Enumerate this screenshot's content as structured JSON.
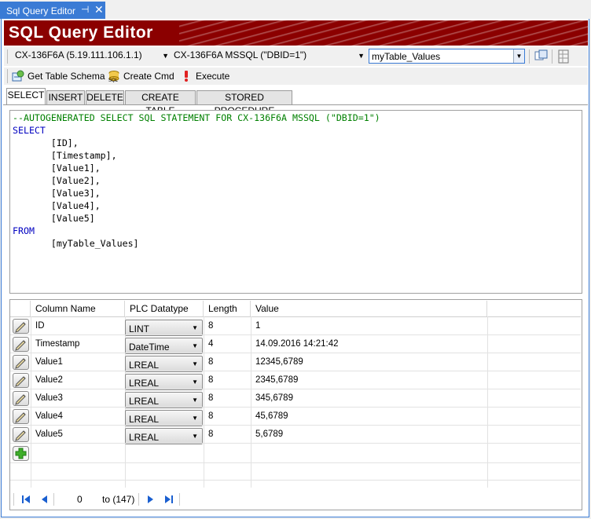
{
  "window": {
    "tab_title": "Sql Query Editor",
    "pin_glyph": "⊣",
    "close_glyph": "✕"
  },
  "banner": {
    "title": "SQL Query Editor"
  },
  "connection": {
    "server": "CX-136F6A (5.19.111.106.1.1)",
    "database": "CX-136F6A MSSQL (\"DBID=1\")",
    "table": "myTable_Values"
  },
  "toolbar": {
    "get_schema": "Get Table Schema",
    "create_cmd": "Create Cmd",
    "execute": "Execute"
  },
  "tabs": [
    "SELECT",
    "INSERT",
    "DELETE",
    "CREATE TABLE",
    "STORED PROCEDURE"
  ],
  "sql_lines": [
    "--AUTOGENERATED SELECT SQL STATEMENT FOR CX-136F6A MSSQL (\"DBID=1\")",
    "SELECT",
    "       [ID],",
    "       [Timestamp],",
    "       [Value1],",
    "       [Value2],",
    "       [Value3],",
    "       [Value4],",
    "       [Value5]",
    "FROM",
    "       [myTable_Values]"
  ],
  "grid": {
    "columns": [
      "Column Name",
      "PLC Datatype",
      "Length",
      "Value"
    ],
    "rows": [
      {
        "name": "ID",
        "type": "LINT",
        "length": "8",
        "value": "1"
      },
      {
        "name": "Timestamp",
        "type": "DateTime",
        "length": "4",
        "value": "14.09.2016 14:21:42"
      },
      {
        "name": "Value1",
        "type": "LREAL",
        "length": "8",
        "value": "12345,6789"
      },
      {
        "name": "Value2",
        "type": "LREAL",
        "length": "8",
        "value": "2345,6789"
      },
      {
        "name": "Value3",
        "type": "LREAL",
        "length": "8",
        "value": "345,6789"
      },
      {
        "name": "Value4",
        "type": "LREAL",
        "length": "8",
        "value": "45,6789"
      },
      {
        "name": "Value5",
        "type": "LREAL",
        "length": "8",
        "value": "5,6789"
      }
    ]
  },
  "pager": {
    "current": "0",
    "total_label": "to (147)"
  },
  "colors": {
    "banner": "#8b0000",
    "accent": "#3a7bd5",
    "sql_comment": "#008000",
    "sql_keyword": "#0000c0"
  }
}
